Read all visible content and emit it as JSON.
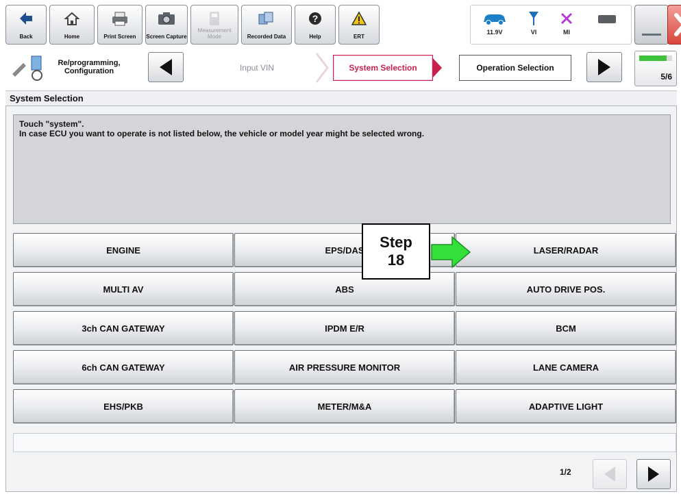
{
  "toolbar": {
    "back": "Back",
    "home": "Home",
    "print_screen": "Print Screen",
    "screen_capture": "Screen Capture",
    "measurement_mode": "Measurement Mode",
    "recorded_data": "Recorded Data",
    "help": "Help",
    "ert": "ERT"
  },
  "status": {
    "battery_voltage": "11.9V",
    "vi_label": "VI",
    "mi_label": "MI"
  },
  "nav": {
    "mode_label": "Re/programming, Configuration",
    "steps": [
      "Input VIN",
      "System Selection",
      "Operation Selection"
    ],
    "active_step": "System Selection",
    "progress_text": "5/6",
    "progress_fraction": 0.83
  },
  "page": {
    "title": "System Selection",
    "instruction_line1": "Touch \"system\".",
    "instruction_line2": "In case ECU you want to operate is not listed below, the vehicle or model year might be selected wrong."
  },
  "systems": [
    [
      "ENGINE",
      "EPS/DAS",
      "LASER/RADAR"
    ],
    [
      "MULTI AV",
      "ABS",
      "AUTO DRIVE POS."
    ],
    [
      "3ch CAN GATEWAY",
      "IPDM E/R",
      "BCM"
    ],
    [
      "6ch CAN GATEWAY",
      "AIR PRESSURE MONITOR",
      "LANE CAMERA"
    ],
    [
      "EHS/PKB",
      "METER/M&A",
      "ADAPTIVE LIGHT"
    ]
  ],
  "pager": {
    "page_info": "1/2"
  },
  "annotation": {
    "line1": "Step",
    "line2": "18"
  },
  "colors": {
    "active_step": "#c91f4c",
    "progress": "#3fc23b",
    "arrow": "#33e03a",
    "close_button": "#d9463d"
  }
}
